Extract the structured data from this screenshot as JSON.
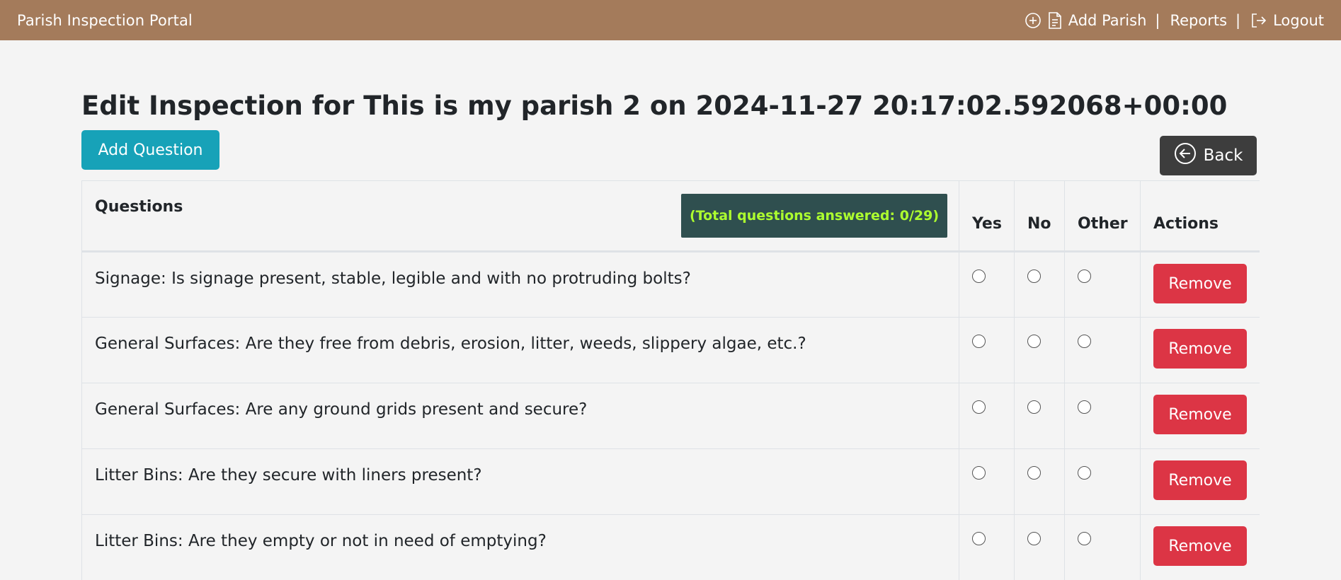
{
  "navbar": {
    "brand": "Parish Inspection Portal",
    "add_parish": "Add Parish",
    "reports": "Reports",
    "logout": "Logout",
    "separator": "|",
    "background_color": "#a47b5b"
  },
  "page": {
    "title": "Edit Inspection for This is my parish 2 on 2024-11-27 20:17:02.592068+00:00",
    "add_question_label": "Add Question",
    "back_label": "Back"
  },
  "table": {
    "headers": {
      "questions": "Questions",
      "yes": "Yes",
      "no": "No",
      "other": "Other",
      "actions": "Actions"
    },
    "answered_badge": "(Total questions answered: 0/29)",
    "remove_label": "Remove",
    "rows": [
      {
        "question": "Signage: Is signage present, stable, legible and with no protruding bolts?"
      },
      {
        "question": "General Surfaces: Are they free from debris, erosion, litter, weeds, slippery algae, etc.?"
      },
      {
        "question": "General Surfaces: Are any ground grids present and secure?"
      },
      {
        "question": "Litter Bins: Are they secure with liners present?"
      },
      {
        "question": "Litter Bins: Are they empty or not in need of emptying?"
      }
    ]
  },
  "colors": {
    "info": "#17a2b8",
    "danger": "#dc3545",
    "dark": "#3d3d3d",
    "badge_bg": "#2f4f4f",
    "badge_text": "#adff2f"
  }
}
